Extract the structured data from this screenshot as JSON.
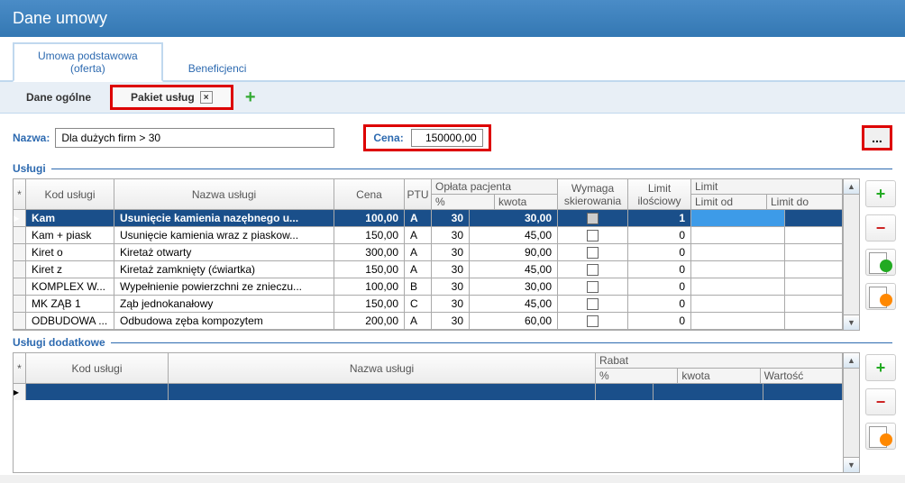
{
  "window_title": "Dane umowy",
  "level1_tabs": {
    "active_line1": "Umowa podstawowa",
    "active_line2": "(oferta)",
    "other": "Beneficjenci"
  },
  "level2_tabs": {
    "general": "Dane ogólne",
    "package": "Pakiet usług"
  },
  "form": {
    "nazwa_label": "Nazwa:",
    "nazwa_value": "Dla dużych firm > 30",
    "cena_label": "Cena:",
    "cena_value": "150000,00",
    "dots": "..."
  },
  "section_uslugi": "Usługi",
  "section_dodatkowe": "Usługi dodatkowe",
  "headers1": {
    "star": "*",
    "kod": "Kod usługi",
    "nazwa": "Nazwa usługi",
    "cena": "Cena",
    "ptu": "PTU",
    "oplata": "Opłata pacjenta",
    "pct": "%",
    "kwota": "kwota",
    "wymaga": "Wymaga skierowania",
    "ilosc": "Limit ilościowy",
    "limit": "Limit",
    "limitod": "Limit od",
    "limitdo": "Limit do"
  },
  "rows1": [
    {
      "kod": "Kam",
      "nazwa": "Usunięcie kamienia nazębnego u...",
      "cena": "100,00",
      "ptu": "A",
      "pct": "30",
      "kwota": "30,00",
      "wymaga": true,
      "ilosc": "1"
    },
    {
      "kod": "Kam + piask",
      "nazwa": "Usunięcie kamienia wraz z piaskow...",
      "cena": "150,00",
      "ptu": "A",
      "pct": "30",
      "kwota": "45,00",
      "wymaga": false,
      "ilosc": "0"
    },
    {
      "kod": "Kiret o",
      "nazwa": "Kiretaż otwarty",
      "cena": "300,00",
      "ptu": "A",
      "pct": "30",
      "kwota": "90,00",
      "wymaga": false,
      "ilosc": "0"
    },
    {
      "kod": "Kiret z",
      "nazwa": "Kiretaż zamknięty (ćwiartka)",
      "cena": "150,00",
      "ptu": "A",
      "pct": "30",
      "kwota": "45,00",
      "wymaga": false,
      "ilosc": "0"
    },
    {
      "kod": "KOMPLEX W...",
      "nazwa": "Wypełnienie powierzchni ze znieczu...",
      "cena": "100,00",
      "ptu": "B",
      "pct": "30",
      "kwota": "30,00",
      "wymaga": false,
      "ilosc": "0"
    },
    {
      "kod": "MK ZĄB 1",
      "nazwa": "Ząb jednokanałowy",
      "cena": "150,00",
      "ptu": "C",
      "pct": "30",
      "kwota": "45,00",
      "wymaga": false,
      "ilosc": "0"
    },
    {
      "kod": "ODBUDOWA ...",
      "nazwa": "Odbudowa zęba kompozytem",
      "cena": "200,00",
      "ptu": "A",
      "pct": "30",
      "kwota": "60,00",
      "wymaga": false,
      "ilosc": "0"
    }
  ],
  "headers2": {
    "star": "*",
    "kod": "Kod usługi",
    "nazwa": "Nazwa usługi",
    "rabat": "Rabat",
    "pct": "%",
    "kwota": "kwota",
    "wartosc": "Wartość"
  },
  "icons": {
    "plus": "+",
    "minus": "−",
    "close": "×",
    "up": "▲",
    "down": "▼",
    "marker": "▸"
  }
}
